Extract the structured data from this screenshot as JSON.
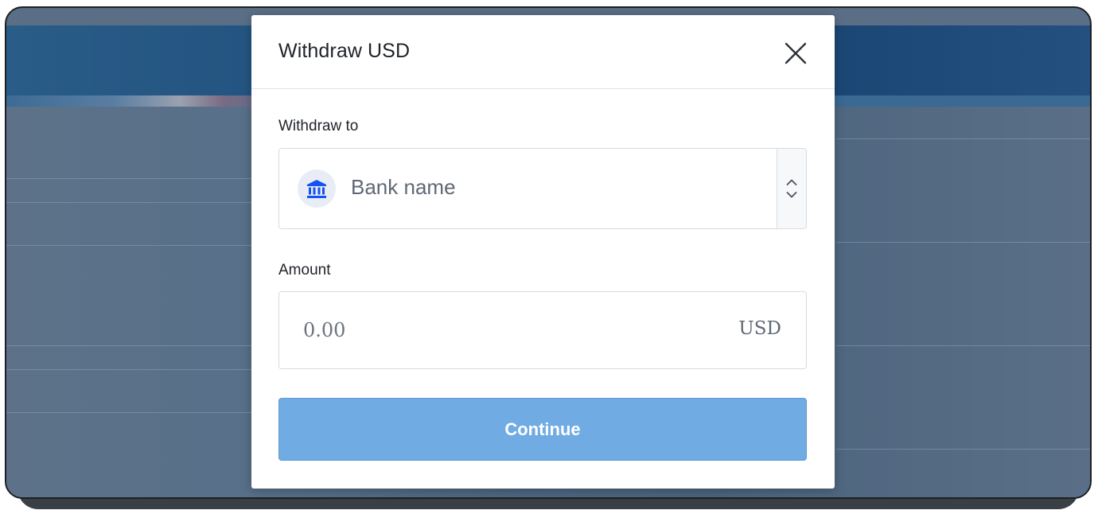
{
  "modal": {
    "title": "Withdraw USD",
    "close_icon": "close-icon"
  },
  "withdraw_to": {
    "label": "Withdraw to",
    "bank_icon": "bank-icon",
    "bank_name": "Bank name",
    "toggle_icon": "chevron-up-down-icon"
  },
  "amount": {
    "label": "Amount",
    "placeholder": "0.00",
    "value": "",
    "currency": "USD"
  },
  "continue_label": "Continue",
  "colors": {
    "accent": "#70abe3",
    "bank_icon": "#1652f0"
  }
}
